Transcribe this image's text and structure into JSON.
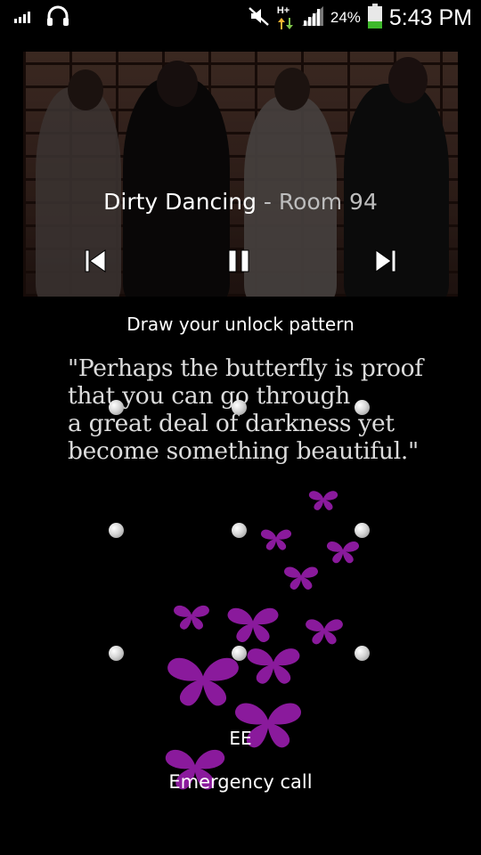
{
  "status_bar": {
    "time": "5:43 PM",
    "battery_percent": "24%",
    "network_type": "H+",
    "icons": [
      "signal-bars-small-icon",
      "headphones-icon",
      "mute-icon",
      "data-arrows-icon",
      "signal-bars-icon",
      "battery-icon"
    ],
    "battery_color": "#3fb82c"
  },
  "media": {
    "song_title": "Dirty Dancing",
    "separator": "-",
    "artist": "Room 94",
    "controls": [
      "previous-icon",
      "pause-icon",
      "next-icon"
    ]
  },
  "unlock": {
    "prompt": "Draw your unlock pattern",
    "quote_lines": [
      "\"Perhaps the butterfly is proof",
      "that you can go through",
      "a great deal of darkness yet",
      "become something beautiful.\""
    ]
  },
  "footer": {
    "carrier": "EE",
    "emergency_call": "Emergency call"
  },
  "colors": {
    "butterfly": "#8a1a9c",
    "background": "#000000"
  }
}
